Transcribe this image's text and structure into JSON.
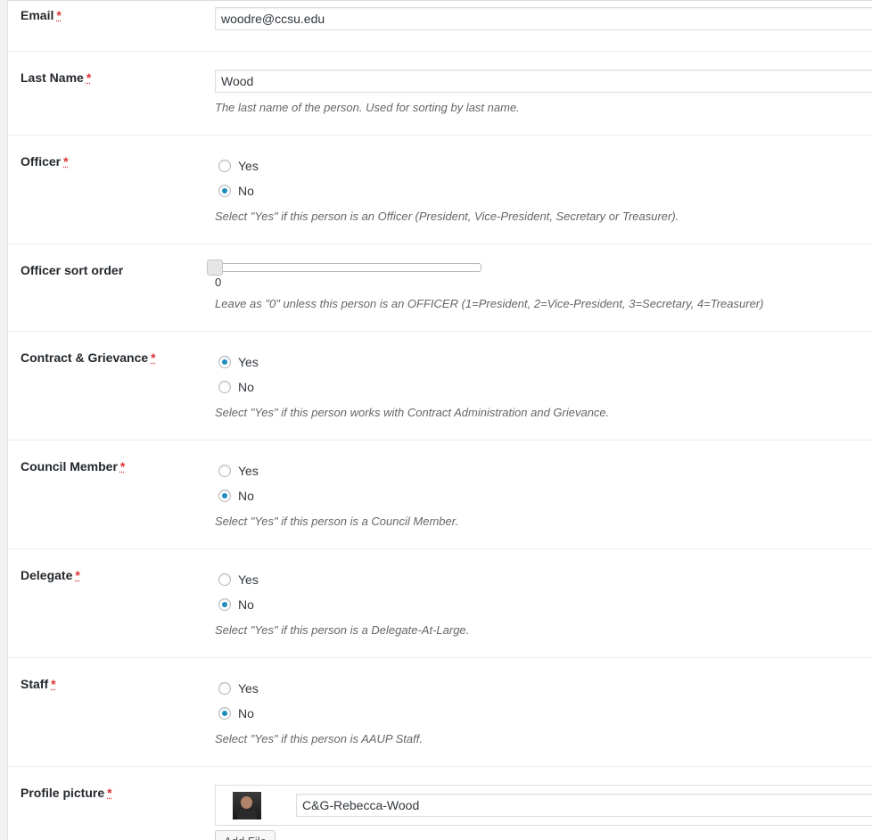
{
  "required_mark": "*",
  "email": {
    "label": "Email",
    "value": "woodre@ccsu.edu"
  },
  "last_name": {
    "label": "Last Name",
    "value": "Wood",
    "description": "The last name of the person. Used for sorting by last name."
  },
  "officer": {
    "label": "Officer",
    "options": [
      "Yes",
      "No"
    ],
    "selected": "No",
    "description": "Select \"Yes\" if this person is an Officer (President, Vice-President, Secretary or Treasurer)."
  },
  "officer_sort_order": {
    "label": "Officer sort order",
    "value": "0",
    "slider_fraction": 0,
    "description": "Leave as \"0\" unless this person is an OFFICER (1=President, 2=Vice-President, 3=Secretary, 4=Treasurer)"
  },
  "contract_grievance": {
    "label": "Contract & Grievance",
    "options": [
      "Yes",
      "No"
    ],
    "selected": "Yes",
    "description": "Select \"Yes\" if this person works with Contract Administration and Grievance."
  },
  "council_member": {
    "label": "Council Member",
    "options": [
      "Yes",
      "No"
    ],
    "selected": "No",
    "description": "Select \"Yes\" if this person is a Council Member."
  },
  "delegate": {
    "label": "Delegate",
    "options": [
      "Yes",
      "No"
    ],
    "selected": "No",
    "description": "Select \"Yes\" if this person is a Delegate-At-Large."
  },
  "staff": {
    "label": "Staff",
    "options": [
      "Yes",
      "No"
    ],
    "selected": "No",
    "description": "Select \"Yes\" if this person is AAUP Staff."
  },
  "profile_picture": {
    "label": "Profile picture",
    "file_title": "C&G-Rebecca-Wood",
    "add_button_label": "Add File"
  },
  "colors": {
    "required": "#dc3232",
    "radio_checked": "#1e8cbe",
    "description_text": "#666666"
  }
}
